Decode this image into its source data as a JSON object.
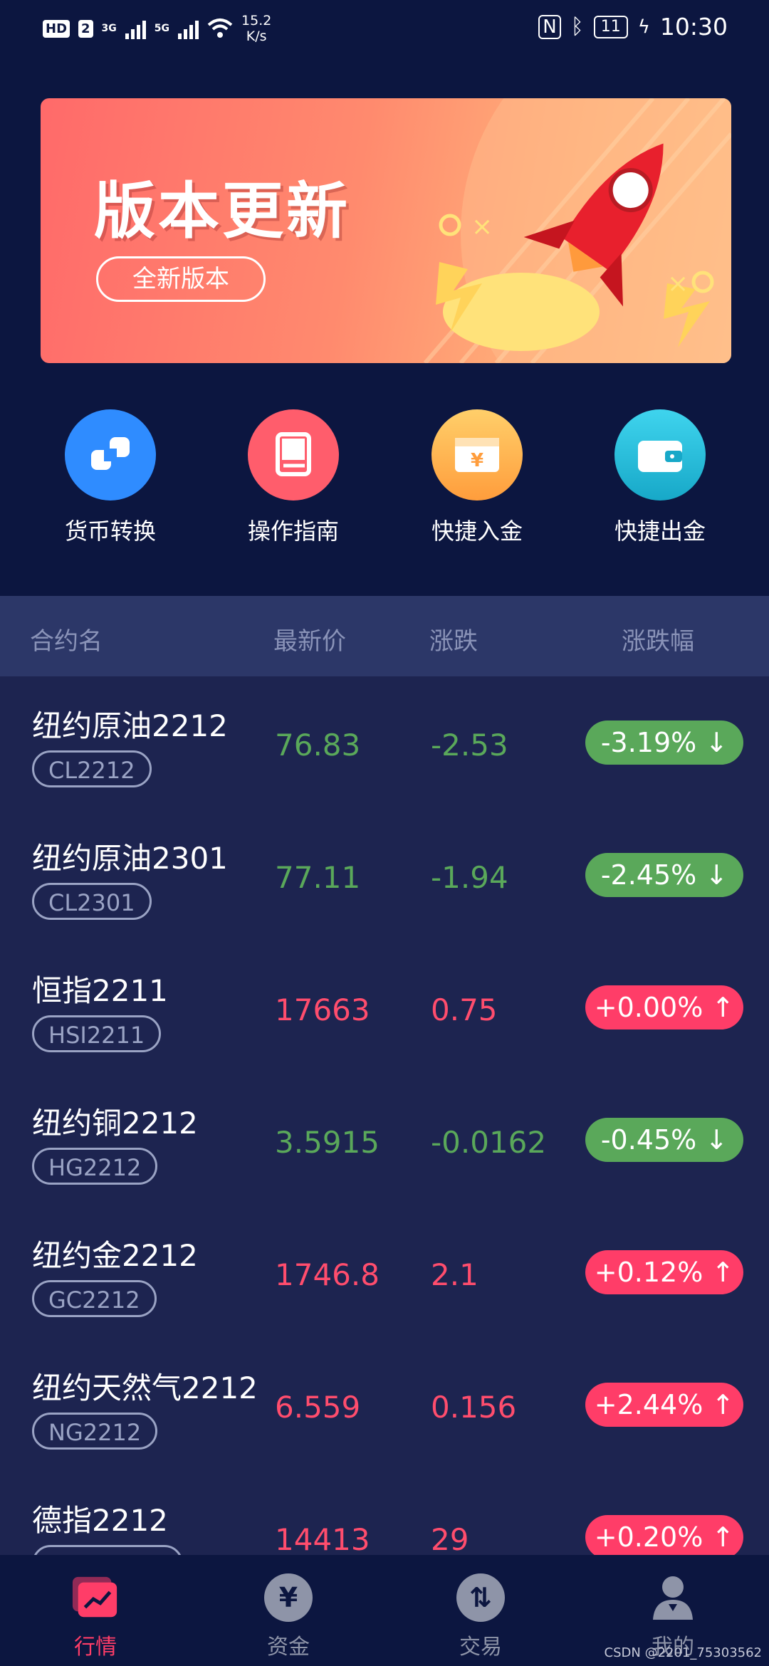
{
  "status_bar": {
    "hd": "HD",
    "sim": "2",
    "net1": "3G",
    "net2": "5G",
    "speed_value": "15.2",
    "speed_unit": "K/s",
    "battery": "11",
    "time": "10:30"
  },
  "banner": {
    "title": "版本更新",
    "pill": "全新版本"
  },
  "quick_actions": [
    {
      "label": "货币转换",
      "icon": "currency-exchange-icon",
      "color": "#2f8cff"
    },
    {
      "label": "操作指南",
      "icon": "book-icon",
      "color": "#ff5d6c"
    },
    {
      "label": "快捷入金",
      "icon": "yuan-card-icon",
      "color": "#ffad4d"
    },
    {
      "label": "快捷出金",
      "icon": "wallet-icon",
      "color": "#22c1de"
    }
  ],
  "table": {
    "headers": {
      "name": "合约名",
      "price": "最新价",
      "change": "涨跌",
      "pct": "涨跌幅"
    },
    "rows": [
      {
        "name": "纽约原油2212",
        "code": "CL2212",
        "price": "76.83",
        "change": "-2.53",
        "pct": "-3.19% ↓",
        "dir": "down"
      },
      {
        "name": "纽约原油2301",
        "code": "CL2301",
        "price": "77.11",
        "change": "-1.94",
        "pct": "-2.45% ↓",
        "dir": "down"
      },
      {
        "name": "恒指2211",
        "code": "HSI2211",
        "price": "17663",
        "change": "0.75",
        "pct": "+0.00% ↑",
        "dir": "up"
      },
      {
        "name": "纽约铜2212",
        "code": "HG2212",
        "price": "3.5915",
        "change": "-0.0162",
        "pct": "-0.45% ↓",
        "dir": "down"
      },
      {
        "name": "纽约金2212",
        "code": "GC2212",
        "price": "1746.8",
        "change": "2.1",
        "pct": "+0.12% ↑",
        "dir": "up"
      },
      {
        "name": "纽约天然气2212",
        "code": "NG2212",
        "price": "6.559",
        "change": "0.156",
        "pct": "+2.44% ↑",
        "dir": "up"
      },
      {
        "name": "德指2212",
        "code": "",
        "price": "14413",
        "change": "29",
        "pct": "+0.20% ↑",
        "dir": "up"
      }
    ]
  },
  "nav": {
    "items": [
      {
        "label": "行情",
        "icon": "market-chart-icon"
      },
      {
        "label": "资金",
        "icon": "yuan-icon"
      },
      {
        "label": "交易",
        "icon": "trade-arrows-icon"
      },
      {
        "label": "我的",
        "icon": "user-icon"
      }
    ],
    "active": "行情"
  },
  "watermark": "CSDN @2201_75303562",
  "colors": {
    "up": "#ff3d68",
    "down": "#5aa85a",
    "background": "#0c1640",
    "list_bg": "#1d2450"
  }
}
